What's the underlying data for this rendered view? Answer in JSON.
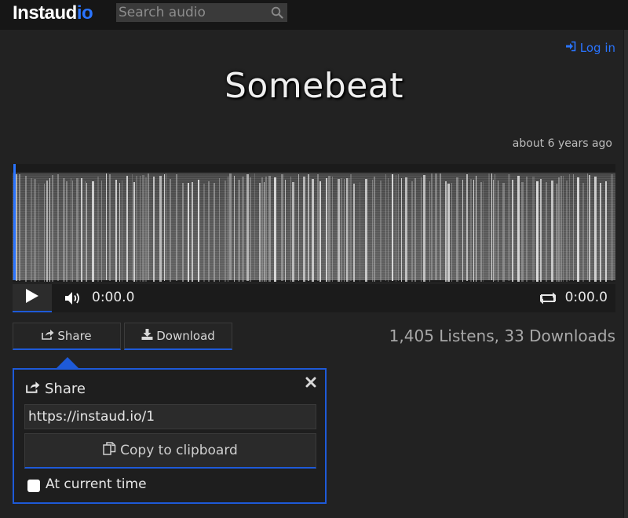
{
  "app": {
    "logo_part1": "Instaud",
    "logo_part2": "io",
    "brand_color": "#2a74ff"
  },
  "search": {
    "placeholder": "Search audio",
    "icon": "search-icon"
  },
  "header": {
    "login_label": "Log in",
    "login_icon": "sign-in-icon"
  },
  "track": {
    "title": "Somebeat",
    "timestamp": "about 6 years ago",
    "progress": 0.0
  },
  "player": {
    "play_icon": "play-icon",
    "volume_icon": "volume-icon",
    "loop_icon": "loop-icon",
    "current_time": "0:00.0",
    "duration": "0:00.0"
  },
  "actions": {
    "share_label": "Share",
    "share_icon": "share-icon",
    "download_label": "Download",
    "download_icon": "download-icon"
  },
  "stats": {
    "text": "1,405 Listens, 33 Downloads"
  },
  "share_panel": {
    "title": "Share",
    "url": "https://instaud.io/1",
    "copy_label": "Copy to clipboard",
    "copy_icon": "clipboard-icon",
    "close_icon": "close-icon",
    "at_time_label": "At current time",
    "at_time_checked": false
  }
}
